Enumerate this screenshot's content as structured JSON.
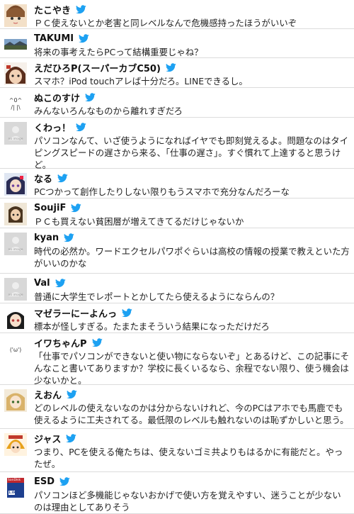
{
  "feed": {
    "accent_color": "#1da1f2",
    "posts": [
      {
        "name": "たこやき",
        "text": "ＰＣ使えないとか老害と同レベルなんで危機感持ったほうがいいぞ",
        "avatar_icon": "anime-character-avatar-icon"
      },
      {
        "name": "TAKUMI",
        "text": "将来の事考えたらPCって結構重要じゃね？",
        "avatar_icon": "landscape-photo-avatar-icon"
      },
      {
        "name": "えだひろP(スーパーカブC50)",
        "text": "スマホ？iPod touchアレば十分だろ。LINEできるし。",
        "avatar_icon": "anime-character-avatar-icon"
      },
      {
        "name": "ぬこのすけ",
        "text": "みんないろんなものから離れすぎだろ",
        "avatar_icon": "kaomoji-avatar-icon"
      },
      {
        "name": "くわっ！",
        "text": "パソコンなんて、いざ使うようになればイヤでも即刻覚えるよ。問題なのはタイピングスピードの遅さから来る、「仕事の遅さ」。すぐ慣れて上達すると思うけど。",
        "avatar_icon": "no-image-avatar-icon",
        "no_image_label": "no image"
      },
      {
        "name": "なる",
        "text": "PCつかって創作したりしない限りもうスマホで充分なんだろーな",
        "avatar_icon": "anime-character-avatar-icon"
      },
      {
        "name": "SoujiF",
        "text": "ＰＣも買えない貧困層が増えてきてるだけじゃないか",
        "avatar_icon": "anime-character-avatar-icon"
      },
      {
        "name": "kyan",
        "text": "時代の必然か。ワードエクセルパワポぐらいは高校の情報の授業で教えといた方がいいのかな",
        "avatar_icon": "no-image-avatar-icon",
        "no_image_label": "no image"
      },
      {
        "name": "Val",
        "text": "普通に大学生でレポートとかしてたら使えるようにならんの？",
        "avatar_icon": "no-image-avatar-icon",
        "no_image_label": "no image"
      },
      {
        "name": "マゼラーにーよんっ",
        "text": "標本が怪しすぎる。たまたまそういう結果になっただけだろ",
        "avatar_icon": "anime-character-avatar-icon"
      },
      {
        "name": "イワちゃんP",
        "text": "「仕事でパソコンができないと使い物にならないぞ」とあるけど、この記事にそんなこと書いてありますか？学校に長くいるなら、余程でない限り、使う機会は少ないかと。",
        "avatar_icon": "kaomoji-avatar-icon"
      },
      {
        "name": "えおん",
        "text": "どのレベルの使えないなのかは分からないけれど、今のPCはアホでも馬鹿でも使えるように工夫されてる。最低限のレベルも触れないのは恥ずかしいと思う。",
        "avatar_icon": "anime-character-avatar-icon"
      },
      {
        "name": "ジャス",
        "text": "つまり、PCを使える俺たちは、使えないゴミ共よりもはるかに有能だと。やったぜ。",
        "avatar_icon": "anime-character-avatar-icon"
      },
      {
        "name": "ESD",
        "text": "パソコンほど多機能じゃないおかげで使い方を覚えやすい、迷うことが少ないのは理由としてありそう",
        "avatar_icon": "memory-card-avatar-icon",
        "card_label": "SanDisk",
        "card_size": "1.0GB"
      }
    ]
  }
}
